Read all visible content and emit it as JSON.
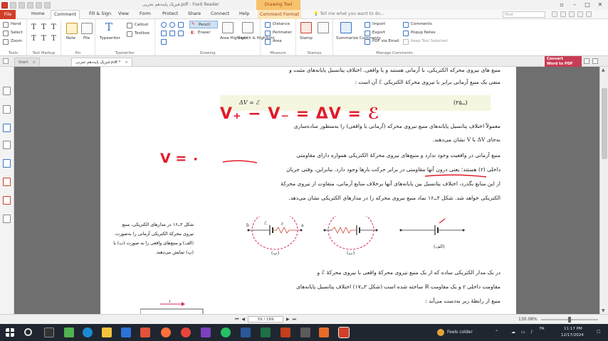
{
  "app": {
    "title": "فیزیک پایه‌دهم تجربی.pdf - Foxit Reader",
    "context_tool": "Drawing Tool"
  },
  "menu": {
    "file": "File",
    "tabs": [
      "Home",
      "Comment",
      "Fill & Sign",
      "View",
      "Form",
      "Protect",
      "Share",
      "Connect",
      "Help",
      "Comment Format"
    ],
    "tell_me": "Tell me what you want to do...",
    "find_placeholder": "Find"
  },
  "ribbon": {
    "groups": {
      "tools": "Tools",
      "text_markup": "Text Markup",
      "pin": "Pin",
      "typewriter": "Typewriter",
      "drawing": "Drawing",
      "measure": "Measure",
      "stamps": "Stamps",
      "manage_comments": "Manage Comments"
    },
    "tools": [
      "Hand",
      "Select",
      "Zoom"
    ],
    "pin": [
      "Note",
      "File"
    ],
    "typewriter": [
      "Typewriter",
      "Callout",
      "Textbox"
    ],
    "drawing": [
      "Pencil",
      "Eraser",
      "Area Highlight",
      "Search & Highlight"
    ],
    "measure": [
      "Distance",
      "Perimeter",
      "Area"
    ],
    "stamps": "Stamp",
    "manage": [
      "Summarize Comments",
      "Import",
      "Export",
      "PDF via Email",
      "Comments",
      "Popup Notes",
      "Keep Tool Selected"
    ]
  },
  "doc_tabs": {
    "start": "Start",
    "file": "فیزیک پایه‌دهم تجربی.pdf *",
    "convert_1": "Convert",
    "convert_2": "Word to PDF"
  },
  "page": {
    "line_1": "منبع های نیروی محرکه الکتریکی، با آرمانی هستند و یا واقعی. اختلاف پتانسیل پایانه‌های مثبت و",
    "line_2": "منفی یک منبع آرمانی برابر با نیروی محرکهٔ الکتریکی ℰ آن است :",
    "equation": "ΔV = ℰ",
    "eq_number": "(۲ــ۵)",
    "para_1a": "معمولاً اختلاف پتانسیل پایانه‌های منبع نیروی محرکه (آرمانی یا واقعی) را به‌منظور ساده‌سازی",
    "para_1b": "به‌جای ΔV با V نشان می‌دهند.",
    "para_2a": "منبع آرمانی در واقعیت وجود ندارد و منبع‌های نیروی محرکهٔ الکتریکی همواره دارای مقاومتی",
    "para_2b": "داخلی (r) هستند؛ یعنی درون آنها مقاومتی در برابر حرکت بارها وجود دارد. بنابراین، وقتی جریان",
    "para_2c": "از این منابع بگذرد، اختلاف پتانسیل بین پایانه‌های آنها برخلاف منابع آرمانی، متفاوت از نیروی محرکهٔ",
    "para_2d": "الکتریکی خواهد شد. شکل ۲ــ۱۶ نماد منبع نیروی محرکه را در مدارهای الکتریکی نشان می‌دهد.",
    "caption_1": "شکل ۲ــ۱۶ در مدارهای الکتریکی، منبع",
    "caption_2": "نیروی محرکهٔ الکتریکی آرمانی را به‌صورت",
    "caption_3": "(الف) و منبع‌های واقعی را به صورت (ب) یا",
    "caption_4": "(پ) نمایش می‌دهند.",
    "fig_labels": [
      "(الف)",
      "(ب)",
      "(پ)"
    ],
    "circuit_labels": {
      "b": "b",
      "a": "a",
      "emf": "ℰ",
      "r": "r"
    },
    "para_3a": "در یک مدار الکتریکی ساده که از یک منبع نیروی محرکهٔ واقعی با نیروی محرکهٔ ℰ و",
    "para_3b": "مقاومت داخلی r و یک مقاومت R ساخته شده است (شکل ۲ــ۱۷) اختلاف پتانسیل پایانه‌های",
    "para_3c": "منبع از رابطهٔ زیر به‌دست می‌آید :",
    "fig17_label": "I"
  },
  "handwriting": {
    "equation": "V₊ − V₋ = ΔV = ℰ",
    "v_zero": "V = ۰"
  },
  "status": {
    "page": "59 / 169",
    "zoom": "130.08%"
  },
  "taskbar": {
    "weather": "Feels colder",
    "time": "11:17 PM",
    "date": "12/17/2024",
    "lang": "FA"
  },
  "colors": {
    "accent_red": "#d13f2a",
    "ink": "#e11a2a",
    "equation_bg": "#f4f6df",
    "figure_circle": "#d62a6e"
  }
}
